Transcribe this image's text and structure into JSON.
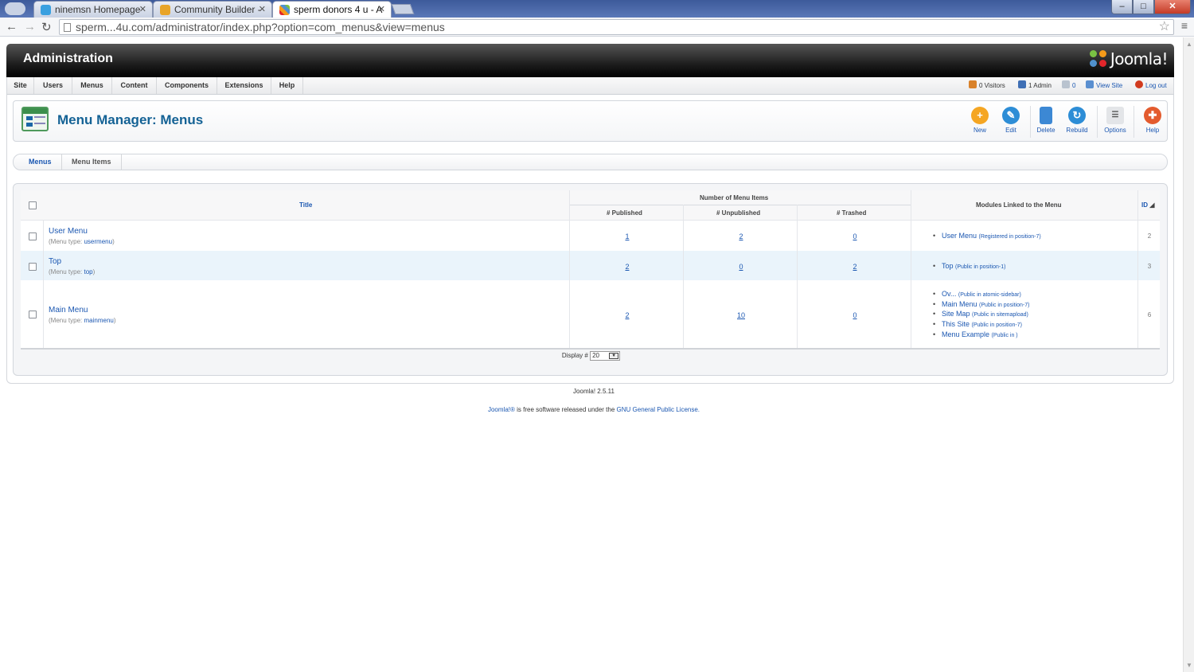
{
  "browser": {
    "tabs": [
      {
        "label": "ninemsn Homepage",
        "active": false
      },
      {
        "label": "Community Builder -",
        "active": false
      },
      {
        "label": "sperm donors 4 u - A",
        "active": true
      }
    ],
    "url": "sperm...4u.com/administrator/index.php?option=com_menus&view=menus",
    "min": "–",
    "max": "□",
    "close": "✕"
  },
  "header": {
    "title": "Administration",
    "logo_text": "Joomla!"
  },
  "menubar": {
    "items": [
      "Site",
      "Users",
      "Menus",
      "Content",
      "Components",
      "Extensions",
      "Help"
    ],
    "status": {
      "visitors": "0 Visitors",
      "admin": "1 Admin",
      "messages": "0",
      "view_site": "View Site",
      "logout": "Log out"
    }
  },
  "toolbar": {
    "page_title": "Menu Manager: Menus",
    "buttons": {
      "new": "New",
      "edit": "Edit",
      "delete": "Delete",
      "rebuild": "Rebuild",
      "options": "Options",
      "help": "Help"
    }
  },
  "subtabs": {
    "menus": "Menus",
    "menu_items": "Menu Items"
  },
  "table": {
    "headers": {
      "title": "Title",
      "number_group": "Number of Menu Items",
      "published": "# Published",
      "unpublished": "# Unpublished",
      "trashed": "# Trashed",
      "modules": "Modules Linked to the Menu",
      "id": "ID"
    },
    "rows": [
      {
        "title": "User Menu",
        "type_prefix": "(Menu type:",
        "type": "usermenu",
        "type_suffix": ")",
        "published": "1",
        "unpublished": "2",
        "trashed": "0",
        "modules": [
          {
            "name": "User Menu",
            "detail": "(Registered in position-7)"
          }
        ],
        "id": "2"
      },
      {
        "title": "Top",
        "type_prefix": "(Menu type:",
        "type": "top",
        "type_suffix": ")",
        "published": "2",
        "unpublished": "0",
        "trashed": "2",
        "modules": [
          {
            "name": "Top",
            "detail": "(Public in position-1)"
          }
        ],
        "id": "3"
      },
      {
        "title": "Main Menu",
        "type_prefix": "(Menu type:",
        "type": "mainmenu",
        "type_suffix": ")",
        "published": "2",
        "unpublished": "10",
        "trashed": "0",
        "modules": [
          {
            "name": "Ov...",
            "detail": "(Public in atomic-sidebar)"
          },
          {
            "name": "Main Menu",
            "detail": "(Public in position-7)"
          },
          {
            "name": "Site Map",
            "detail": "(Public in sitemapload)"
          },
          {
            "name": "This Site",
            "detail": "(Public in position-7)"
          },
          {
            "name": "Menu Example",
            "detail": "(Public in )"
          }
        ],
        "id": "6"
      }
    ],
    "display_label": "Display #",
    "display_value": "20"
  },
  "footer": {
    "version": "Joomla! 2.5.11",
    "license_link1": "Joomla!®",
    "license_text": " is free software released under the ",
    "license_link2": "GNU General Public License."
  }
}
